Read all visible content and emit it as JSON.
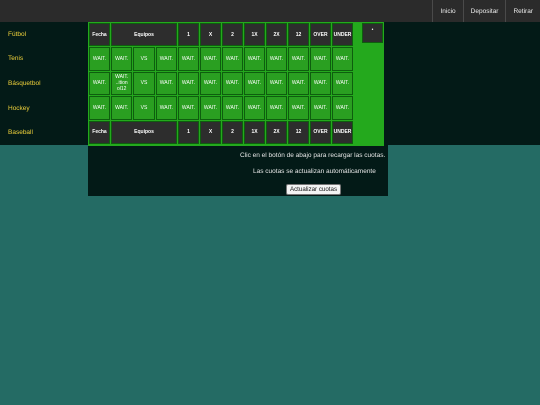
{
  "topnav": {
    "inicio": "Inicio",
    "depositar": "Depositar",
    "retirar": "Retirar"
  },
  "sidebar": {
    "items": [
      {
        "label": "Fútbol"
      },
      {
        "label": "Tenis"
      },
      {
        "label": "Básquetbol"
      },
      {
        "label": "Hockey"
      },
      {
        "label": "Baseball"
      }
    ]
  },
  "table": {
    "headers": [
      "Fecha",
      "Equipos",
      "1",
      "X",
      "2",
      "1X",
      "2X",
      "12",
      "OVER",
      "UNDER"
    ],
    "corner": "•",
    "rows": [
      {
        "fecha": "WAIT.",
        "team1": "WAIT.",
        "vs": "VS",
        "team2": "WAIT.",
        "odds": [
          "WAIT.",
          "WAIT.",
          "WAIT.",
          "WAIT.",
          "WAIT.",
          "WAIT.",
          "WAIT.",
          "WAIT."
        ]
      },
      {
        "fecha": "WAIT.",
        "team1": "WAIT. ..ition ol12",
        "vs": "VS",
        "team2": "WAIT.",
        "odds": [
          "WAIT.",
          "WAIT.",
          "WAIT.",
          "WAIT.",
          "WAIT.",
          "WAIT.",
          "WAIT.",
          "WAIT."
        ]
      },
      {
        "fecha": "WAIT.",
        "team1": "WAIT.",
        "vs": "VS",
        "team2": "WAIT.",
        "odds": [
          "WAIT.",
          "WAIT.",
          "WAIT.",
          "WAIT.",
          "WAIT.",
          "WAIT.",
          "WAIT.",
          "WAIT."
        ]
      }
    ]
  },
  "messages": {
    "line1": "Clic en el botón de abajo para recargar las cuotas.",
    "line2": "Las cuotas se actualizan automáticamente",
    "button": "Actualizar cuotas"
  }
}
